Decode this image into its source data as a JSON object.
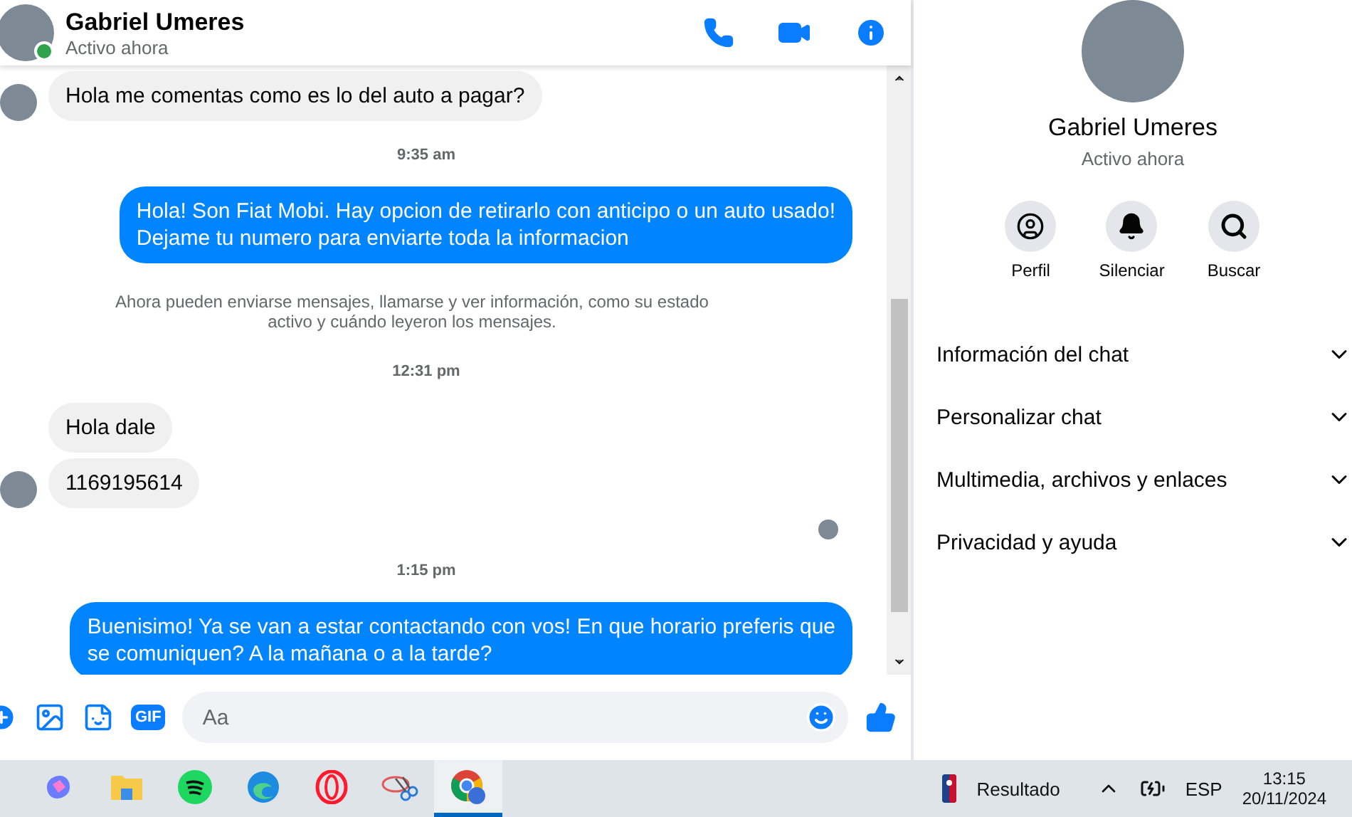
{
  "header": {
    "name": "Gabriel Umeres",
    "status": "Activo ahora",
    "online": true
  },
  "messages": [
    {
      "kind": "incoming",
      "text": "Hola me comentas como es lo del auto a pagar?",
      "avatar": true
    },
    {
      "kind": "time",
      "text": "9:35 am"
    },
    {
      "kind": "outgoing",
      "text": "Hola! Son Fiat Mobi. Hay opcion de retirarlo con anticipo o un auto usado!\nDejame tu numero para enviarte toda la informacion"
    },
    {
      "kind": "notice",
      "text": "Ahora pueden enviarse mensajes, llamarse y ver información, como su estado\nactivo y cuándo leyeron los mensajes."
    },
    {
      "kind": "time",
      "text": "12:31 pm"
    },
    {
      "kind": "incoming",
      "text": "Hola dale",
      "avatar": false
    },
    {
      "kind": "incoming",
      "text": "1169195614",
      "avatar": true
    },
    {
      "kind": "seen"
    },
    {
      "kind": "time",
      "text": "1:15 pm"
    },
    {
      "kind": "outgoing",
      "text": "Buenisimo! Ya se van a estar contactando con vos! En que horario preferis que\nse comuniquen? A la mañana o a la tarde?"
    }
  ],
  "composer": {
    "gif_label": "GIF",
    "placeholder": "Aa"
  },
  "profile": {
    "name": "Gabriel Umeres",
    "status": "Activo ahora",
    "actions": [
      {
        "kind": "profile",
        "label": "Perfil"
      },
      {
        "kind": "mute",
        "label": "Silenciar"
      },
      {
        "kind": "search",
        "label": "Buscar"
      }
    ]
  },
  "sections": [
    {
      "label": "Información del chat",
      "expanded": false
    },
    {
      "label": "Personalizar chat",
      "expanded": false
    },
    {
      "label": "Multimedia, archivos y enlaces",
      "expanded": false
    },
    {
      "label": "Privacidad y ayuda",
      "expanded": false
    }
  ],
  "taskbar": {
    "apps": [
      {
        "kind": "copilot",
        "selected": false
      },
      {
        "kind": "folder",
        "selected": false
      },
      {
        "kind": "music",
        "selected": false
      },
      {
        "kind": "edge",
        "selected": false
      },
      {
        "kind": "opera",
        "selected": false
      },
      {
        "kind": "snip",
        "selected": false
      },
      {
        "kind": "chrome",
        "selected": true
      }
    ],
    "widget": "Resultado",
    "language": "ESP",
    "time": "13:15",
    "date": "20/11/2024"
  }
}
